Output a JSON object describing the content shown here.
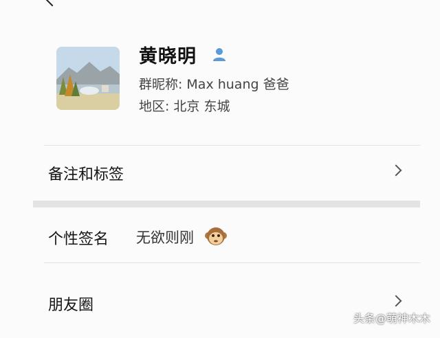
{
  "profile": {
    "name": "黄晓明",
    "nickname_label": "群昵称:",
    "nickname": "Max huang 爸爸",
    "region_label": "地区:",
    "region": "北京 东城",
    "avatar_icon": "landscape-avatar",
    "badge_icon": "person-icon"
  },
  "rows": {
    "remark": {
      "label": "备注和标签",
      "icon": "chevron-right-icon"
    },
    "signature": {
      "label": "个性签名",
      "value": "无欲则刚",
      "emoji": "monkey-face-icon"
    },
    "moments": {
      "label": "朋友圈",
      "icon": "chevron-right-icon"
    }
  },
  "watermark": "头条@萌神木木",
  "colors": {
    "background": "#fbfbfb",
    "section_gap": "#e3e3e3",
    "badge": "#5b9bd5"
  }
}
